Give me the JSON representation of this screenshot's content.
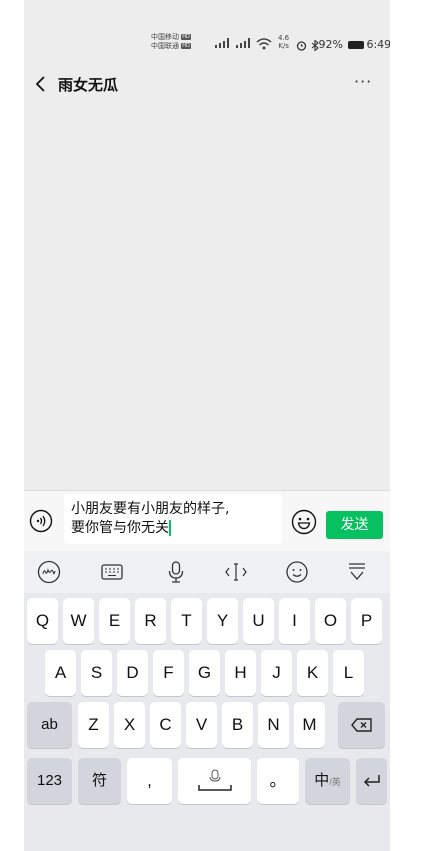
{
  "status_bar": {
    "carrier1": "中国移动",
    "carrier2": "中国联通",
    "hd_badge": "HD",
    "net_speed_value": "4.6",
    "net_speed_unit": "K/s",
    "battery_percent": "92%",
    "time": "6:49"
  },
  "header": {
    "title": "雨女无瓜",
    "more": "···"
  },
  "input": {
    "line1": "小朋友要有小朋友的样子,",
    "line2": "要你管与你无关",
    "send_label": "发送"
  },
  "keyboard": {
    "row1": [
      "Q",
      "W",
      "E",
      "R",
      "T",
      "Y",
      "U",
      "I",
      "O",
      "P"
    ],
    "row2": [
      "A",
      "S",
      "D",
      "F",
      "G",
      "H",
      "J",
      "K",
      "L"
    ],
    "row3": [
      "Z",
      "X",
      "C",
      "V",
      "B",
      "N",
      "M"
    ],
    "shift_label": "ab",
    "num_label": "123",
    "symbol_label": "符",
    "comma_label": ",",
    "period_label": "。",
    "lang_label": "中",
    "lang_sub_label": "/英"
  },
  "colors": {
    "accent": "#07c160",
    "chat_bg": "#ededed",
    "keyboard_bg": "#e8e9ec"
  },
  "icons": {
    "back": "chevron-left-icon",
    "more": "more-dots-icon",
    "voice": "voice-icon",
    "emoji": "emoji-icon",
    "backspace": "backspace-icon",
    "enter": "enter-icon"
  }
}
